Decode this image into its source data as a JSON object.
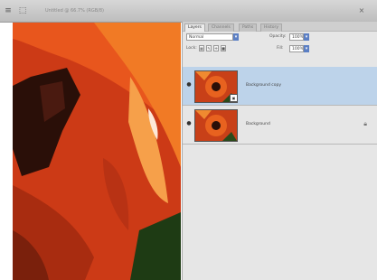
{
  "app": {
    "title": "Untitled @ 66.7% (RGB/8)",
    "toolbar_icons": [
      "menu-icon",
      "select-icon"
    ],
    "close_label": "×"
  },
  "layers_panel": {
    "tabs": [
      {
        "label": "Layers",
        "active": true
      },
      {
        "label": "Channels",
        "active": false
      },
      {
        "label": "Paths",
        "active": false
      },
      {
        "label": "History",
        "active": false
      }
    ],
    "blend_mode": "Normal",
    "opacity_label": "Opacity:",
    "opacity_value": "100%",
    "lock_label": "Lock:",
    "fill_label": "Fill:",
    "fill_value": "100%",
    "layers": [
      {
        "name": "Background copy",
        "selected": true,
        "visible": true,
        "locked": false
      },
      {
        "name": "Background",
        "selected": false,
        "visible": true,
        "locked": true
      }
    ]
  },
  "colors": {
    "selection": "#bdd3ea",
    "accent": "#5b7fc4",
    "flower_red": "#d2471a",
    "flower_orange": "#f07a22"
  }
}
